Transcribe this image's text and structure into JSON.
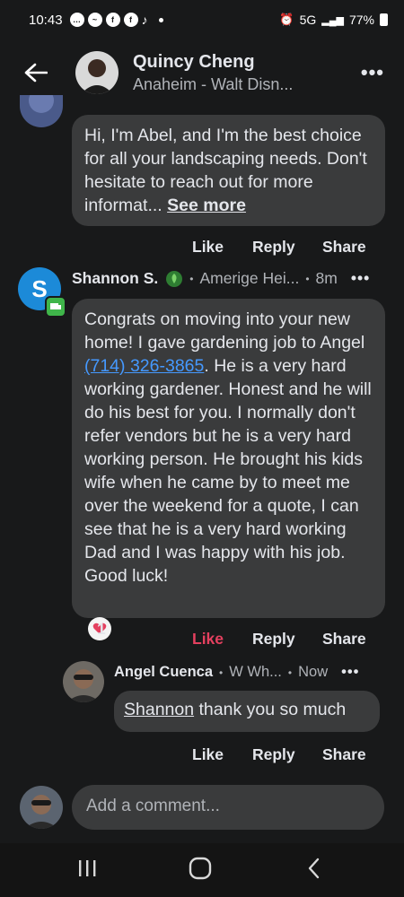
{
  "status": {
    "time": "10:43",
    "network": "5G",
    "battery": "77%"
  },
  "header": {
    "back_icon": "back-arrow-icon",
    "name": "Quincy Cheng",
    "subtitle": "Anaheim - Walt Disn...",
    "more_icon": "more-dots-icon"
  },
  "post1": {
    "text": "Hi, I'm Abel, and I'm the best choice for all your landscaping needs. Don't hesitate to reach out for more informat...",
    "see_more": "See more",
    "actions": {
      "like": "Like",
      "reply": "Reply",
      "share": "Share"
    }
  },
  "post2": {
    "avatar_letter": "S",
    "name": "Shannon S.",
    "location": "Amerige Hei...",
    "time": "8m",
    "text_before": "Congrats on moving into your new home!  I gave gardening job to Angel ",
    "phone": "(714) 326-3865",
    "text_after": ".  He is a very hard working gardener. Honest and he will do his best for you.  I normally don't refer vendors but he is a very hard working person.  He brought his kids wife when he came by to meet me over the weekend for a quote, I can see that he is a very hard working Dad and I was happy with his job.  Good luck!",
    "reaction_count": "1",
    "actions": {
      "like": "Like",
      "reply": "Reply",
      "share": "Share"
    },
    "like_color": "#e4405f"
  },
  "reply": {
    "name": "Angel Cuenca",
    "location": "W Wh...",
    "time": "Now",
    "mention": "Shannon",
    "text": " thank you so much",
    "actions": {
      "like": "Like",
      "reply": "Reply",
      "share": "Share"
    }
  },
  "composer": {
    "placeholder": "Add a comment..."
  }
}
